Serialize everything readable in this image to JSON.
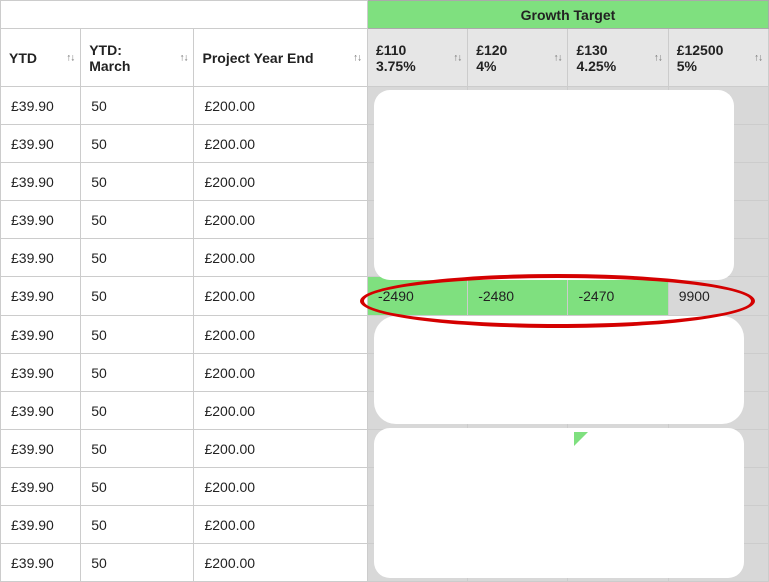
{
  "header": {
    "growth_target_label": "Growth Target",
    "left_cols": [
      {
        "label": "YTD"
      },
      {
        "label_line1": "YTD:",
        "label_line2": "March"
      },
      {
        "label": "Project Year End"
      }
    ],
    "growth_cols": [
      {
        "amount": "£110",
        "rate": "3.75%"
      },
      {
        "amount": "£120",
        "rate": "4%"
      },
      {
        "amount": "£130",
        "rate": "4.25%"
      },
      {
        "amount": "£12500",
        "rate": "5%"
      }
    ]
  },
  "rows": [
    {
      "ytd": "£39.90",
      "march": "50",
      "pye": "£200.00"
    },
    {
      "ytd": "£39.90",
      "march": "50",
      "pye": "£200.00"
    },
    {
      "ytd": "£39.90",
      "march": "50",
      "pye": "£200.00"
    },
    {
      "ytd": "£39.90",
      "march": "50",
      "pye": "£200.00"
    },
    {
      "ytd": "£39.90",
      "march": "50",
      "pye": "£200.00"
    },
    {
      "ytd": "£39.90",
      "march": "50",
      "pye": "£200.00",
      "g": [
        "-2490",
        "-2480",
        "-2470",
        "9900"
      ],
      "g_green": [
        true,
        true,
        true,
        false
      ]
    },
    {
      "ytd": "£39.90",
      "march": "50",
      "pye": "£200.00"
    },
    {
      "ytd": "£39.90",
      "march": "50",
      "pye": "£200.00"
    },
    {
      "ytd": "£39.90",
      "march": "50",
      "pye": "£200.00"
    },
    {
      "ytd": "£39.90",
      "march": "50",
      "pye": "£200.00"
    },
    {
      "ytd": "£39.90",
      "march": "50",
      "pye": "£200.00"
    },
    {
      "ytd": "£39.90",
      "march": "50",
      "pye": "£200.00"
    },
    {
      "ytd": "£39.90",
      "march": "50",
      "pye": "£200.00"
    }
  ],
  "sort_glyph": "↑↓"
}
